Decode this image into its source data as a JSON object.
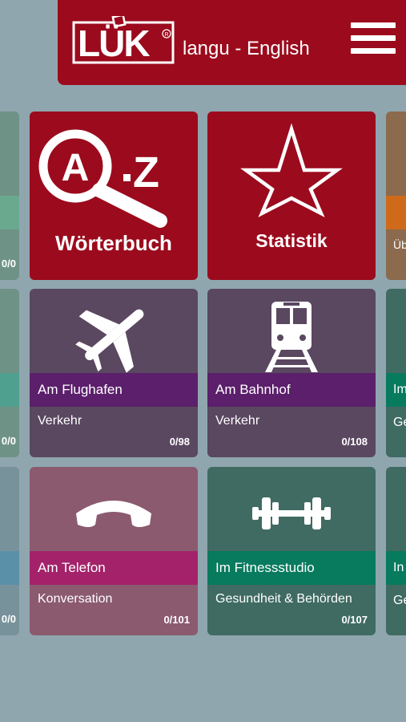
{
  "header": {
    "logo_text": "LÜK",
    "title": "langu - English",
    "menu_icon": "hamburger-menu-icon",
    "color": "#9b0b1d"
  },
  "tiles": {
    "dictionary": {
      "label": "Wörterbuch",
      "icon": "a-z-magnifier-icon",
      "color": "#9b0b1d"
    },
    "statistics": {
      "label": "Statistik",
      "icon": "star-icon",
      "color": "#9b0b1d"
    },
    "airport": {
      "title": "Am Flughafen",
      "category": "Verkehr",
      "count": "0/98",
      "icon": "airplane-icon",
      "color": "#5a4760",
      "band_color": "#5b1f6b"
    },
    "station": {
      "title": "Am Bahnhof",
      "category": "Verkehr",
      "count": "0/108",
      "icon": "train-icon",
      "color": "#5a4760",
      "band_color": "#5b1f6b"
    },
    "phone": {
      "title": "Am Telefon",
      "category": "Konversation",
      "count": "0/101",
      "icon": "telephone-receiver-icon",
      "color": "#8b5a6f",
      "band_color": "#a3226a"
    },
    "fitness": {
      "title": "Im Fitnessstudio",
      "category": "Gesundheit & Behörden",
      "count": "0/107",
      "icon": "dumbbell-icon",
      "color": "#3f6b62",
      "band_color": "#087a5e"
    }
  },
  "edge_left": [
    "0/0",
    "0/0",
    "0/0"
  ],
  "edge_right": [
    "Üb",
    "Im",
    "Ge",
    "In",
    "Ge"
  ]
}
